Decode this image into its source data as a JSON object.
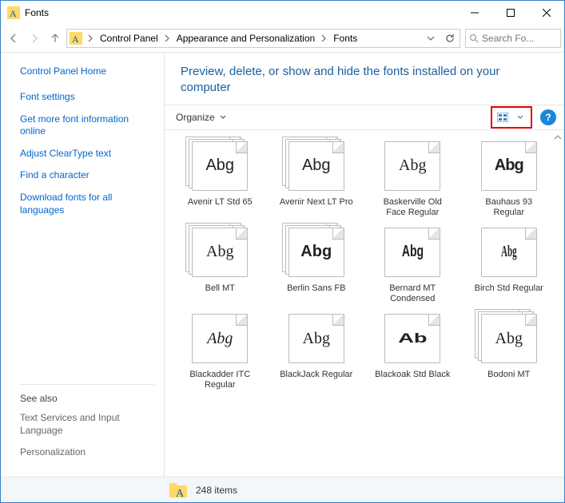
{
  "window": {
    "title": "Fonts"
  },
  "breadcrumb": {
    "items": [
      "Control Panel",
      "Appearance and Personalization",
      "Fonts"
    ]
  },
  "search": {
    "placeholder": "Search Fo..."
  },
  "sidebar": {
    "home": "Control Panel Home",
    "links": [
      "Font settings",
      "Get more font information online",
      "Adjust ClearType text",
      "Find a character",
      "Download fonts for all languages"
    ],
    "see_also_header": "See also",
    "see_also": [
      "Text Services and Input Language",
      "Personalization"
    ]
  },
  "main": {
    "heading": "Preview, delete, or show and hide the fonts installed on your computer",
    "organize_label": "Organize"
  },
  "fonts": [
    {
      "label": "Avenir LT Std 65",
      "sample": "Abg",
      "sample_class": "s-avenir",
      "stack": true
    },
    {
      "label": "Avenir Next LT Pro",
      "sample": "Abg",
      "sample_class": "s-avenirnext",
      "stack": true
    },
    {
      "label": "Baskerville Old Face Regular",
      "sample": "Abg",
      "sample_class": "s-basker",
      "stack": false
    },
    {
      "label": "Bauhaus 93 Regular",
      "sample": "Abg",
      "sample_class": "s-bauhaus",
      "stack": false
    },
    {
      "label": "Bell MT",
      "sample": "Abg",
      "sample_class": "s-bell",
      "stack": true
    },
    {
      "label": "Berlin Sans FB",
      "sample": "Abg",
      "sample_class": "s-berlin",
      "stack": true
    },
    {
      "label": "Bernard MT Condensed",
      "sample": "Abg",
      "sample_class": "s-bernard",
      "stack": false
    },
    {
      "label": "Birch Std Regular",
      "sample": "Abg",
      "sample_class": "s-birch",
      "stack": false
    },
    {
      "label": "Blackadder ITC Regular",
      "sample": "Abg",
      "sample_class": "s-blackadder",
      "stack": false
    },
    {
      "label": "BlackJack Regular",
      "sample": "Abg",
      "sample_class": "s-blackjack",
      "stack": false
    },
    {
      "label": "Blackoak Std Black",
      "sample": "Ab",
      "sample_class": "s-blackoak",
      "stack": false
    },
    {
      "label": "Bodoni MT",
      "sample": "Abg",
      "sample_class": "s-bodoni",
      "stack": true
    }
  ],
  "status": {
    "count_text": "248 items"
  }
}
